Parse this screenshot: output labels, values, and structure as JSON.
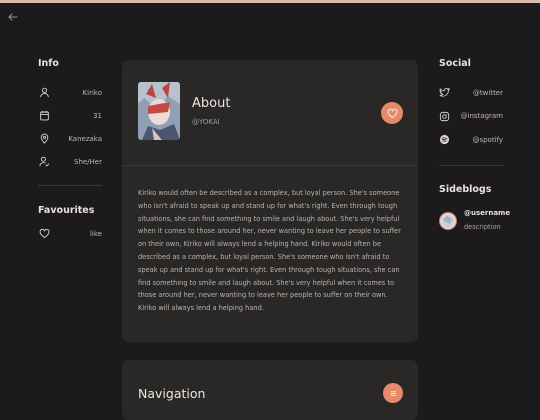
{
  "info": {
    "title": "Info",
    "rows": [
      {
        "icon": "user-icon",
        "value": "Kiriko"
      },
      {
        "icon": "calendar-icon",
        "value": "31"
      },
      {
        "icon": "location-pin-icon",
        "value": "Kanezaka"
      },
      {
        "icon": "user-check-icon",
        "value": "She/Her"
      }
    ]
  },
  "favourites": {
    "title": "Favourites",
    "rows": [
      {
        "icon": "heart-icon",
        "value": "like"
      }
    ]
  },
  "about": {
    "title": "About",
    "handle": "@YOKAI",
    "bio": "Kiriko would often be described as a complex, but loyal person. She's someone who isn't afraid to speak up and stand up for what's right. Even through tough situations, she can find something to smile and laugh about. She's very helpful when it comes to those around her, never wanting to leave her people to suffer on their own, Kiriko will always lend a helping hand. Kiriko would often be described as a complex, but loyal person. She's someone who isn't afraid to speak up and stand up for what's right. Even through tough situations, she can find something to smile and laugh about. She's very helpful when it comes to those around her, never wanting to leave her people to suffer on their own. Kiriko will always lend a helping hand."
  },
  "navigation": {
    "title": "Navigation"
  },
  "social": {
    "title": "Social",
    "links": [
      {
        "icon": "twitter-icon",
        "label": "@twitter"
      },
      {
        "icon": "instagram-icon",
        "label": "@instagram"
      },
      {
        "icon": "spotify-icon",
        "label": "@spotify"
      }
    ]
  },
  "sideblogs": {
    "title": "Sideblogs",
    "items": [
      {
        "name": "@username",
        "description": "description"
      }
    ]
  },
  "colors": {
    "background": "#1c1a1a",
    "card": "#2a2827",
    "accent": "#e88a68",
    "top_bar": "#d9b9a8"
  }
}
